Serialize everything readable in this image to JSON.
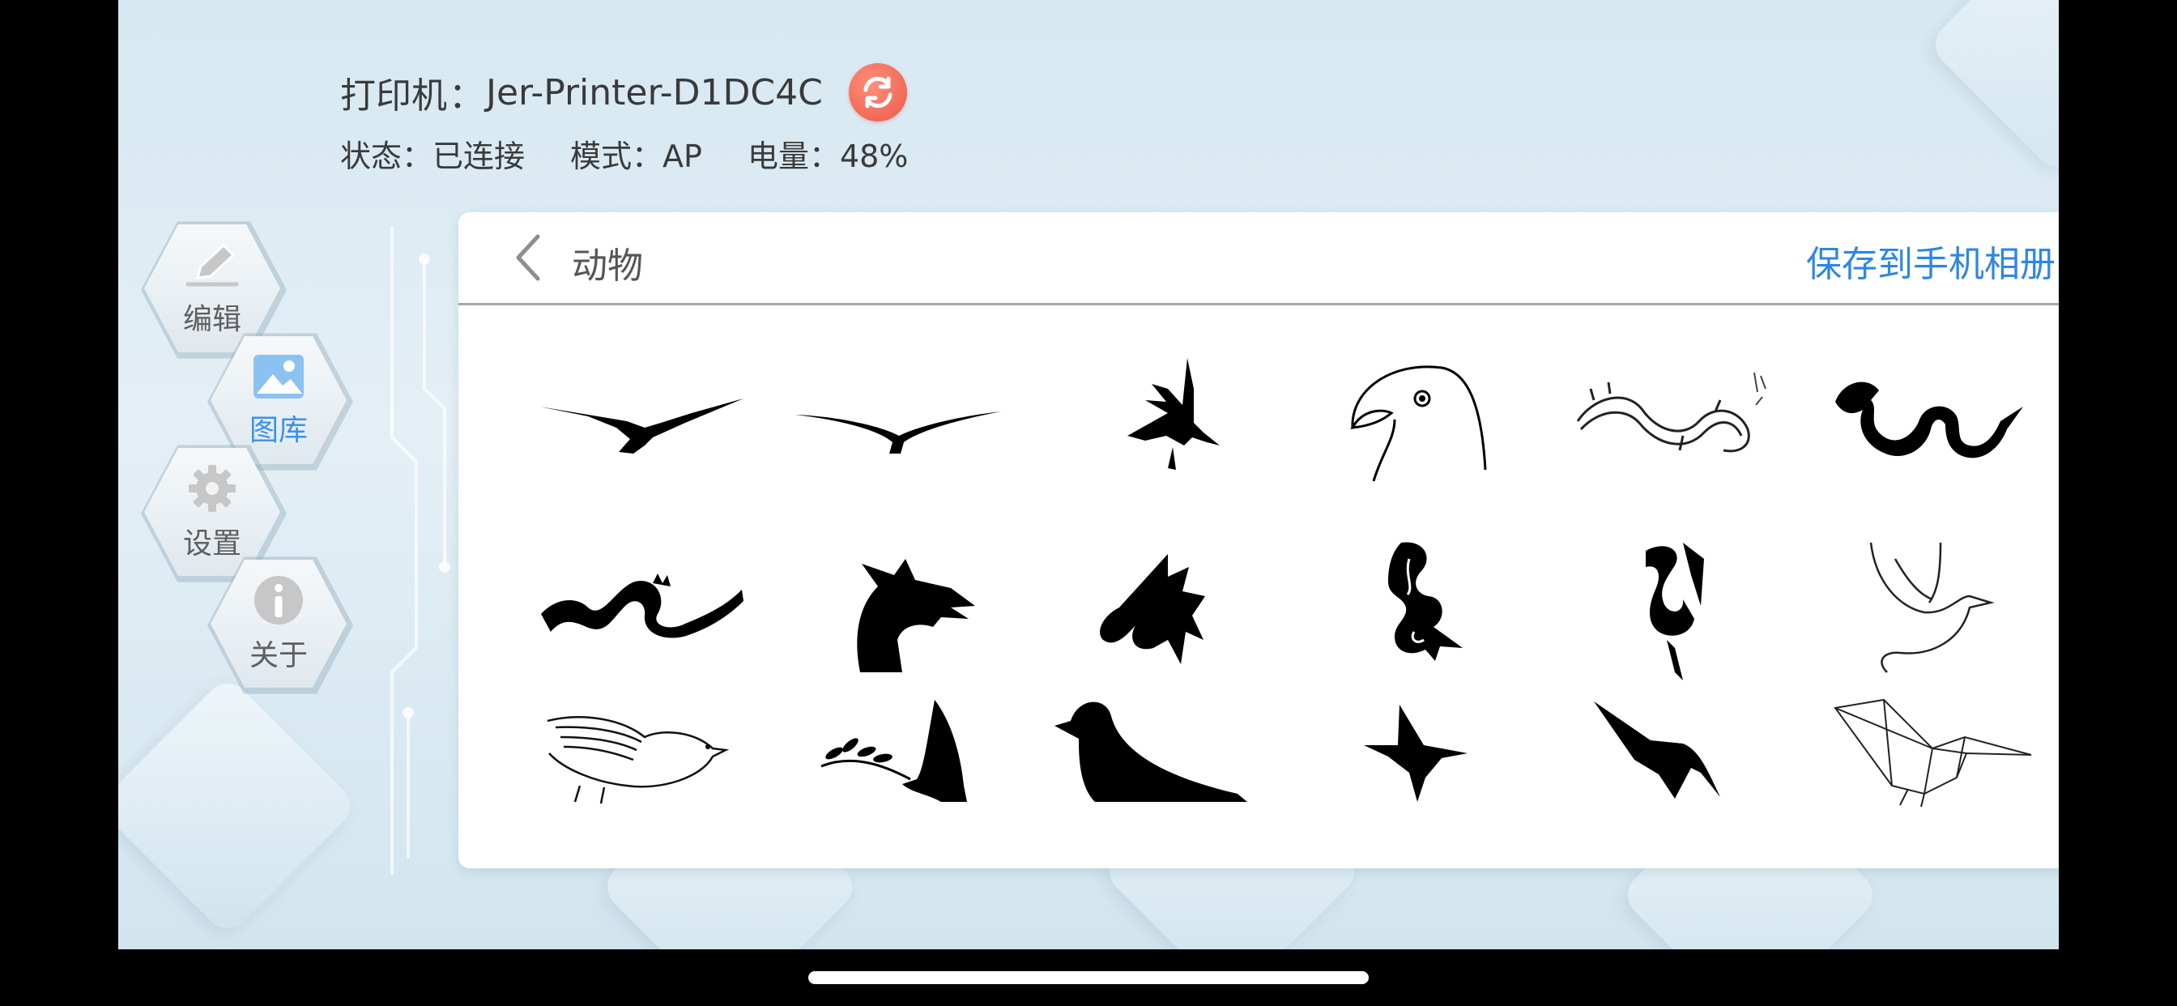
{
  "printer": {
    "label": "打印机",
    "colon": "：",
    "name": "Jer-Printer-D1DC4C",
    "refresh_icon": "refresh-icon"
  },
  "status": {
    "state": "状态：已连接",
    "mode": "模式：AP",
    "battery": "电量：48%"
  },
  "nav": [
    {
      "label": "编辑",
      "icon": "pencil-icon",
      "active": false
    },
    {
      "label": "图库",
      "icon": "image-icon",
      "active": true
    },
    {
      "label": "设置",
      "icon": "gear-icon",
      "active": false
    },
    {
      "label": "关于",
      "icon": "info-icon",
      "active": false
    }
  ],
  "gallery": {
    "title": "动物",
    "save_label": "保存到手机相册",
    "items": [
      "eagle-soaring",
      "eagle-gliding",
      "eagle-wings-up",
      "eagle-head-outline",
      "chinese-dragon-detailed",
      "tribal-dragon-coiled",
      "dragon-serpent",
      "dragon-head-silhouette",
      "winged-dragon",
      "tribal-dragon-vertical",
      "tribal-dragon-swan",
      "dove-outline",
      "ornate-bird",
      "dove-with-olive-branch",
      "pigeon-silhouette",
      "hummingbird-small",
      "hummingbird-silhouette",
      "geometric-hummingbird"
    ]
  },
  "colors": {
    "accent": "#2d86e6",
    "refresh": "#e85a48",
    "nav_active": "#3a92ea"
  }
}
